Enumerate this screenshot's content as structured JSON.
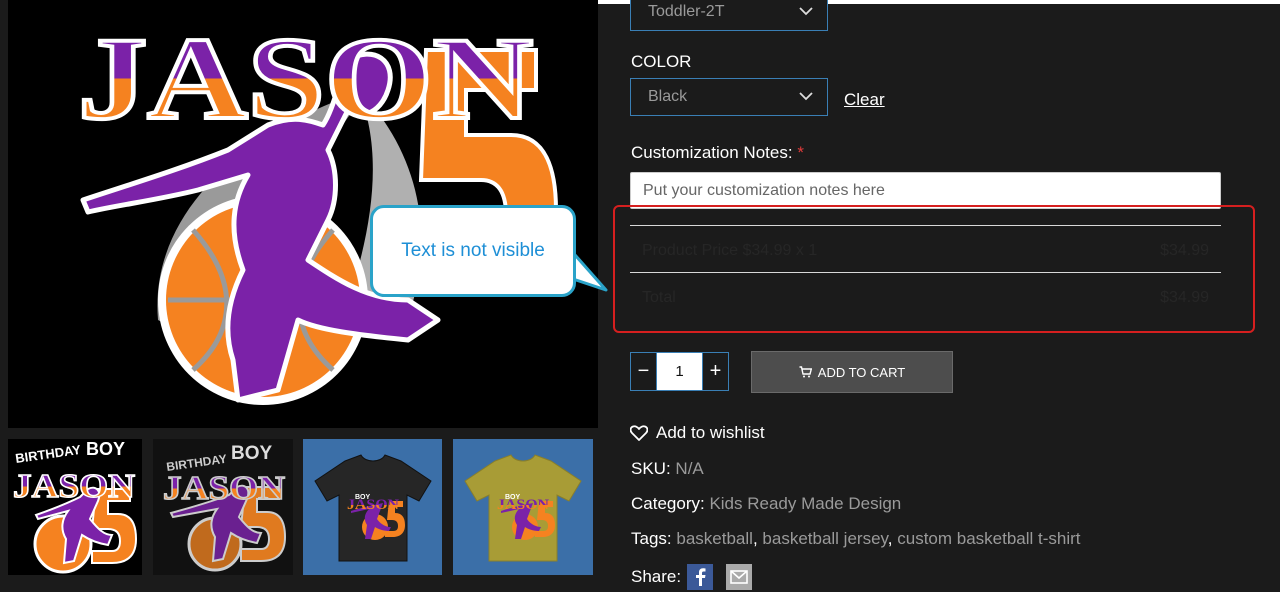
{
  "product": {
    "size_selected": "Toddler-2T",
    "color_label": "COLOR",
    "color_selected": "Black",
    "clear_label": "Clear",
    "notes_label": "Customization Notes:",
    "notes_required": "*",
    "notes_placeholder": "Put your customization notes here",
    "price_rows": [
      {
        "label": "Product Price $34.99 x 1",
        "value": "$34.99"
      },
      {
        "label": "Total",
        "value": "$34.99"
      }
    ],
    "quantity": "1",
    "minus": "−",
    "plus": "+",
    "add_to_cart": "ADD TO CART",
    "wishlist": "Add to wishlist"
  },
  "meta": {
    "sku_label": "SKU:",
    "sku_value": "N/A",
    "category_label": "Category:",
    "category_value": "Kids Ready Made Design",
    "tags_label": "Tags:",
    "tags": [
      "basketball",
      "basketball jersey",
      "custom basketball t-shirt"
    ],
    "share_label": "Share:"
  },
  "artwork": {
    "name": "JASON",
    "number": "5",
    "thumb_line1": "BIRTHDAY",
    "thumb_line2": "BOY"
  },
  "annotation": {
    "callout_text": "Text is not visible"
  },
  "colors": {
    "background": "#1b1b1b",
    "accent_border": "#3a7fb5",
    "highlight_red": "#d61f1f",
    "callout_blue": "#1e8fd6",
    "art_purple": "#7b22a8",
    "art_orange": "#f58220"
  },
  "icons": {
    "dropdown": "chevron-down-icon",
    "cart": "cart-icon",
    "wishlist": "heart-icon",
    "facebook": "facebook-icon",
    "email": "email-icon"
  }
}
